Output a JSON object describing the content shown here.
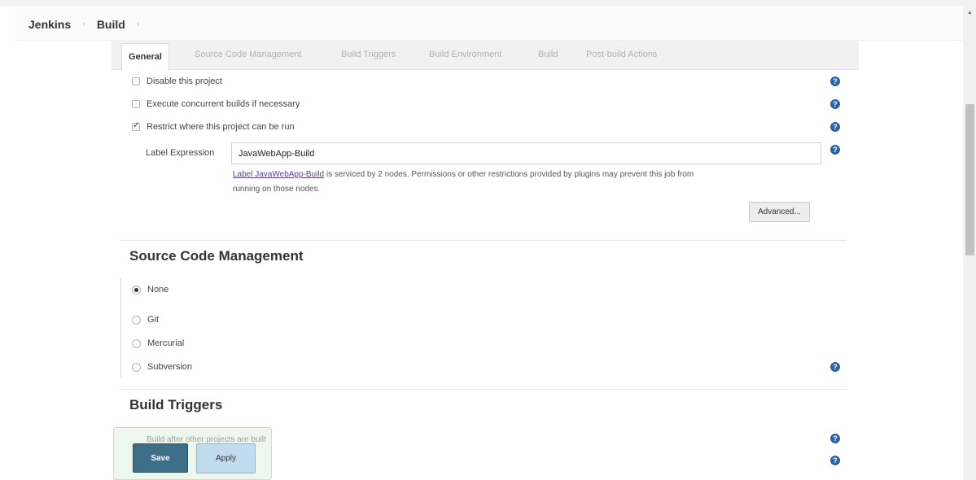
{
  "breadcrumb": {
    "items": [
      "Jenkins",
      "Build"
    ],
    "separator": "›"
  },
  "tabs": [
    {
      "label": "General",
      "active": true
    },
    {
      "label": "Source Code Management",
      "active": false
    },
    {
      "label": "Build Triggers",
      "active": false
    },
    {
      "label": "Build Environment",
      "active": false
    },
    {
      "label": "Build",
      "active": false
    },
    {
      "label": "Post-build Actions",
      "active": false
    }
  ],
  "general": {
    "disable_project": {
      "label": "Disable this project",
      "checked": false
    },
    "concurrent_builds": {
      "label": "Execute concurrent builds if necessary",
      "checked": false
    },
    "restrict_where": {
      "label": "Restrict where this project can be run",
      "checked": true
    },
    "label_expression": {
      "label": "Label Expression",
      "value": "JavaWebApp-Build"
    },
    "label_note": {
      "link_text": "Label JavaWebApp-Build",
      "line1_rest": " is serviced by 2 nodes. Permissions or other restrictions provided by plugins may prevent this job from",
      "line2": "running on those nodes."
    },
    "advanced_button": "Advanced..."
  },
  "scm": {
    "title": "Source Code Management",
    "options": [
      {
        "label": "None",
        "selected": true
      },
      {
        "label": "Git",
        "selected": false
      },
      {
        "label": "Mercurial",
        "selected": false
      },
      {
        "label": "Subversion",
        "selected": false
      }
    ]
  },
  "build_triggers": {
    "title": "Build Triggers",
    "first_item_visible": "Build after other projects are built"
  },
  "actions": {
    "save": "Save",
    "apply": "Apply"
  },
  "help_glyph": "?",
  "colors": {
    "help_icon": "#2c63a8",
    "save_button": "#3e6f88",
    "apply_button": "#c2dcef",
    "link": "#5c3d99"
  }
}
